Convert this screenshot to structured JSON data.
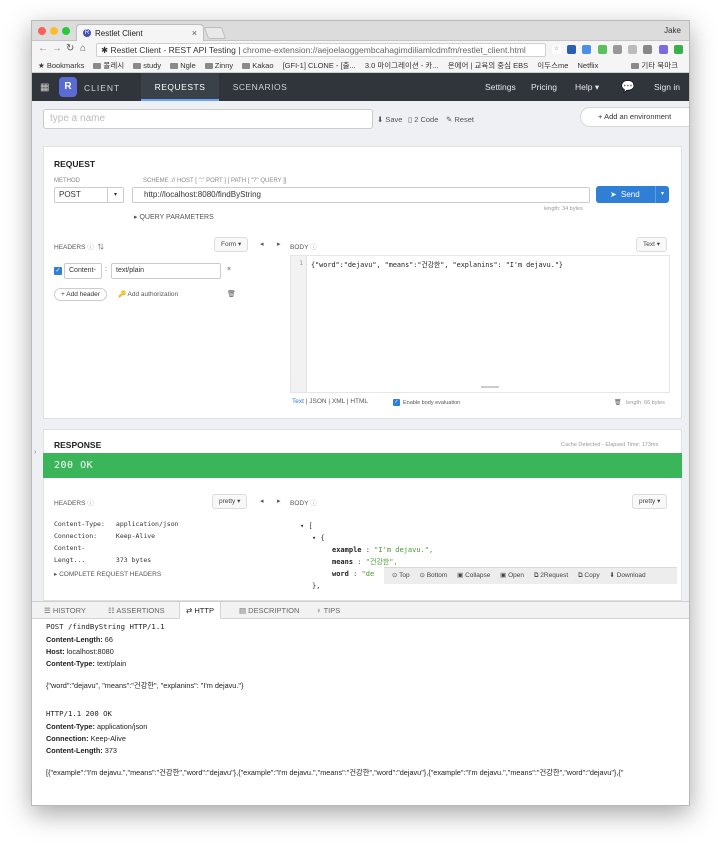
{
  "browser": {
    "tab_title": "Restlet Client",
    "tab_favicon": "R",
    "user": "Jake",
    "omnibox_prefix": "Restlet Client - REST API Testing",
    "omnibox_url": "chrome-extension://aejoelaoggembcahagimdiliamlcdmfm/restlet_client.html",
    "bookmarks": [
      "Bookmarks",
      "몰레시",
      "study",
      "Ngle",
      "Zinny",
      "Kakao",
      "[GFI-1] CLONE - [출...",
      "3.0 마이그레이션 - 카...",
      "온에어 | 교육의 중심 EBS",
      "이두스me",
      "Netflix"
    ],
    "bookmarks_other": "기타 북마크"
  },
  "app": {
    "logo_letter": "R",
    "logo_text": "CLIENT",
    "tabs": [
      "REQUESTS",
      "SCENARIOS"
    ],
    "right_nav": [
      "Settings",
      "Pricing",
      "Help"
    ],
    "signin": "Sign in"
  },
  "toolbar": {
    "name_placeholder": "type a name",
    "save": "Save",
    "code": "2 Code",
    "reset": "Reset",
    "add_env": "Add an environment"
  },
  "request": {
    "title": "REQUEST",
    "method_label": "METHOD",
    "method": "POST",
    "scheme_label": "SCHEME :// HOST [ \":\" PORT ] [ PATH [ \"?\" QUERY ]]",
    "url": "http://localhost:8080/findByString",
    "length": "length: 34 bytes",
    "send": "Send",
    "query_params": "QUERY PARAMETERS",
    "headers_label": "HEADERS",
    "headers_mode": "Form",
    "header_name": "Content-",
    "header_value": "text/plain",
    "add_header": "Add header",
    "add_auth": "Add authorization",
    "body_label": "BODY",
    "body_mode": "Text",
    "body_line_no": "1",
    "body_code": "{\"word\":\"dejavu\", \"means\":\"건강한\", \"explanins\": \"I'm dejavu.\"}",
    "body_formats": [
      "Text",
      "JSON",
      "XML",
      "HTML"
    ],
    "enable_eval": "Enable body evaluation",
    "body_length": "length: 66 bytes"
  },
  "response": {
    "title": "RESPONSE",
    "cache_info": "Cache Detected - Elapsed Time: 173ms",
    "status": "200 OK",
    "headers_label": "HEADERS",
    "headers_mode": "pretty",
    "headers": [
      {
        "name": "Content-Type:",
        "value": "application/json"
      },
      {
        "name": "Connection:",
        "value": "Keep-Alive"
      },
      {
        "name": "Content-Lengt...",
        "value": "373 bytes"
      }
    ],
    "complete_headers": "COMPLETE REQUEST HEADERS",
    "body_label": "BODY",
    "body_mode": "pretty",
    "tree": {
      "open_bracket": "[",
      "open_brace": "{",
      "k1": "example",
      "v1": "\"I'm dejavu.\",",
      "k2": "means",
      "v2": "\"건강한\",",
      "k3": "word",
      "v3": "\"de",
      "close": "},"
    },
    "tree_toolbar": [
      "Top",
      "Bottom",
      "Collapse",
      "Open",
      "2Request",
      "Copy",
      "Download"
    ]
  },
  "drawer": {
    "tabs": [
      "HISTORY",
      "ASSERTIONS",
      "HTTP",
      "DESCRIPTION",
      "TIPS"
    ],
    "req_line": "POST /findByString HTTP/1.1",
    "req_h1_k": "Content-Length:",
    "req_h1_v": "66",
    "req_h2_k": "Host:",
    "req_h2_v": "localhost:8080",
    "req_h3_k": "Content-Type:",
    "req_h3_v": "text/plain",
    "req_body": "{\"word\":\"dejavu\", \"means\":\"건강한\", \"explanins\": \"I'm dejavu.\"}",
    "res_line": "HTTP/1.1 200 OK",
    "res_h1_k": "Content-Type:",
    "res_h1_v": "application/json",
    "res_h2_k": "Connection:",
    "res_h2_v": "Keep-Alive",
    "res_h3_k": "Content-Length:",
    "res_h3_v": "373",
    "res_body": "[{\"example\":\"I'm dejavu.\",\"means\":\"건강한\",\"word\":\"dejavu\"},{\"example\":\"I'm dejavu.\",\"means\":\"건강한\",\"word\":\"dejavu\"},{\"example\":\"I'm dejavu.\",\"means\":\"건강한\",\"word\":\"dejavu\"},{\""
  },
  "colors": {
    "status_green": "#3bb55a",
    "send_blue": "#2f7fd6",
    "nav_dark": "#2f353b"
  }
}
